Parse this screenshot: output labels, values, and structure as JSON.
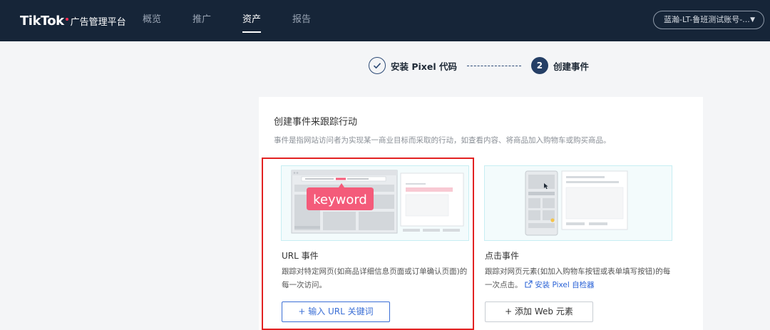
{
  "header": {
    "logo_main": "TikTok",
    "logo_sub": "广告管理平台",
    "nav": [
      {
        "label": "概览",
        "active": false
      },
      {
        "label": "推广",
        "active": false
      },
      {
        "label": "资产",
        "active": true
      },
      {
        "label": "报告",
        "active": false
      }
    ],
    "account": "蓝瀚-LT-鲁班测试账号-..."
  },
  "steps": [
    {
      "label": "安装 Pixel 代码",
      "status": "done"
    },
    {
      "label": "创建事件",
      "number": "2",
      "status": "current"
    }
  ],
  "card": {
    "title": "创建事件来跟踪行动",
    "description": "事件是指网站访问者为实现某一商业目标而采取的行动，如查看内容、将商品加入购物车或购买商品。",
    "options": [
      {
        "name": "URL 事件",
        "description": "跟踪对特定网页(如商品详细信息页面或订单确认页面)的每一次访问。",
        "illustration_text": "keyword",
        "button": "+ 输入 URL 关键词"
      },
      {
        "name": "点击事件",
        "description": "跟踪对网页元素(如加入购物车按钮或表单填写按钮)的每一次点击。",
        "link": "安装 Pixel 自检器",
        "button": "+ 添加 Web 元素"
      }
    ]
  },
  "colors": {
    "topbar": "#162538",
    "accent": "#2b63d6",
    "step": "#253f66",
    "highlight": "#e22222",
    "illustration_border": "#c7eef3",
    "keyword_badge": "#f45b7a"
  }
}
